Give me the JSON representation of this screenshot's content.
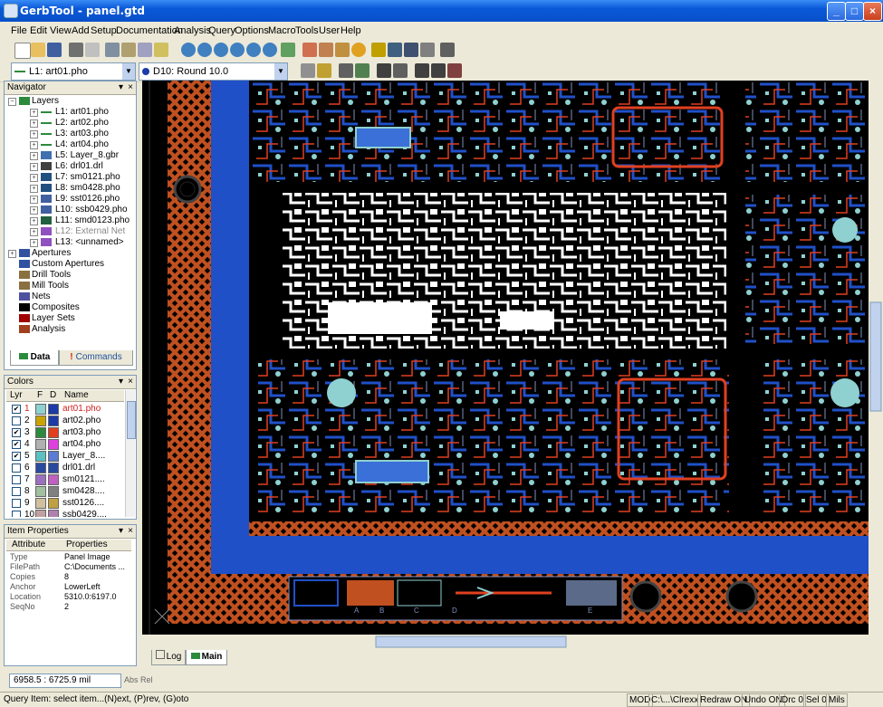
{
  "window": {
    "title": "GerbTool - panel.gtd"
  },
  "menu": [
    "File",
    "Edit",
    "View",
    "Add",
    "Setup",
    "Documentation",
    "Analysis",
    "Query",
    "Options",
    "Macro",
    "Tools",
    "User",
    "Help"
  ],
  "layer_select": {
    "value": "L1: art01.pho"
  },
  "dcode_select": {
    "value": "D10: Round 10.0"
  },
  "navigator": {
    "title": "Navigator",
    "root": "Layers",
    "layers": [
      "L1: art01.pho",
      "L2: art02.pho",
      "L3: art03.pho",
      "L4: art04.pho",
      "L5: Layer_8.gbr",
      "L6: drl01.drl",
      "L7: sm0121.pho",
      "L8: sm0428.pho",
      "L9: sst0126.pho",
      "L10: ssb0429.pho",
      "L11: smd0123.pho",
      "L12: External Net",
      "L13: <unnamed>"
    ],
    "others": [
      "Apertures",
      "Custom Apertures",
      "Drill Tools",
      "Mill Tools",
      "Nets",
      "Composites",
      "Layer Sets",
      "Analysis"
    ],
    "tabs": [
      "Data",
      "Commands"
    ]
  },
  "colors": {
    "title": "Colors",
    "headers": [
      "Lyr",
      "F",
      "D",
      "Name"
    ],
    "rows": [
      {
        "checked": true,
        "num": "1",
        "name": "art01.pho",
        "f": "#8fd0d0",
        "d": "#1c3aa8"
      },
      {
        "checked": false,
        "num": "2",
        "name": "art02.pho",
        "f": "#c9a400",
        "d": "#1c3aa8"
      },
      {
        "checked": true,
        "num": "3",
        "name": "art03.pho",
        "f": "#2c8a3c",
        "d": "#e04020"
      },
      {
        "checked": true,
        "num": "4",
        "name": "art04.pho",
        "f": "#b0b0b0",
        "d": "#e040e0"
      },
      {
        "checked": true,
        "num": "5",
        "name": "Layer_8....",
        "f": "#5bc0c0",
        "d": "#5b7cd0"
      },
      {
        "checked": false,
        "num": "6",
        "name": "drl01.drl",
        "f": "#2a4aa0",
        "d": "#2a4aa0"
      },
      {
        "checked": false,
        "num": "7",
        "name": "sm0121....",
        "f": "#9c70c0",
        "d": "#c060c0"
      },
      {
        "checked": false,
        "num": "8",
        "name": "sm0428....",
        "f": "#a0c0a0",
        "d": "#808080"
      },
      {
        "checked": false,
        "num": "9",
        "name": "sst0126....",
        "f": "#d0c0a0",
        "d": "#c0a040"
      },
      {
        "checked": false,
        "num": "10",
        "name": "ssb0429....",
        "f": "#c0a0a0",
        "d": "#b080b0"
      }
    ]
  },
  "item_properties": {
    "title": "Item Properties",
    "headers": [
      "Attribute",
      "Properties"
    ],
    "rows": [
      {
        "k": "Type",
        "v": "Panel Image"
      },
      {
        "k": "FilePath",
        "v": "C:\\Documents ..."
      },
      {
        "k": "Copies",
        "v": "8"
      },
      {
        "k": "Anchor",
        "v": "LowerLeft"
      },
      {
        "k": "Location",
        "v": "5310.0:6197.0"
      },
      {
        "k": "SeqNo",
        "v": "2"
      }
    ]
  },
  "canvas_tabs": [
    "Log",
    "Main"
  ],
  "coords": {
    "value": "6958.5 : 6725.9 mil",
    "abs": "Abs",
    "rel": "Rel"
  },
  "status": {
    "message": "Query Item: select item...(N)ext, (P)rev, (G)oto",
    "cells": [
      "MOD",
      "C:\\...\\Clrexx",
      "Redraw ON",
      "Undo ON",
      "Drc 0",
      "Sel 0",
      "Mils"
    ]
  },
  "panel_labels": [
    "A",
    "B",
    "C",
    "D",
    "E"
  ],
  "colors_theme": {
    "board_border": "#c05020",
    "board_blue": "#2050c8",
    "copper_red": "#e04020",
    "pad_cyan": "#8fd0d0"
  }
}
